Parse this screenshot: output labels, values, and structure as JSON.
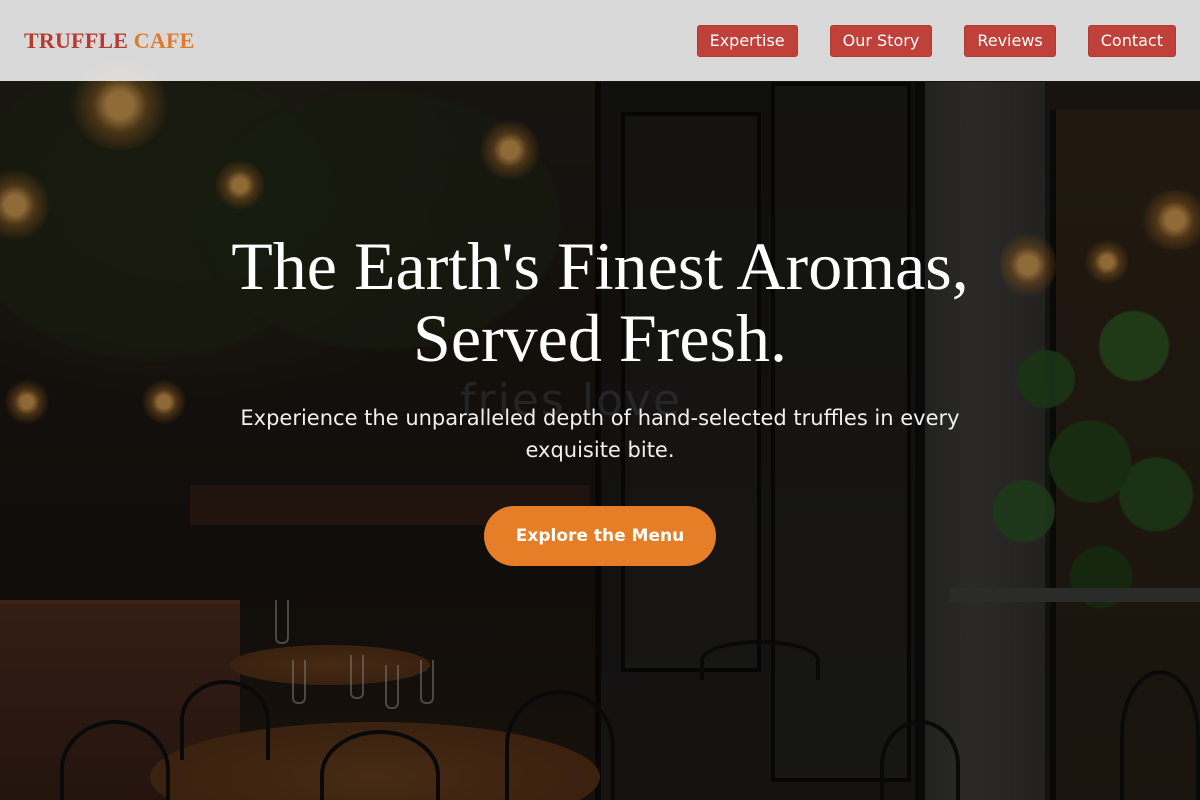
{
  "brand": {
    "word1": "TRUFFLE",
    "word2": "CAFE",
    "color_primary": "#b73a2f",
    "color_secondary": "#e07a2a"
  },
  "nav": {
    "items": [
      {
        "label": "Expertise"
      },
      {
        "label": "Our Story"
      },
      {
        "label": "Reviews"
      },
      {
        "label": "Contact"
      }
    ],
    "button_color": "#c0413a"
  },
  "hero": {
    "headline_line1": "The Earth's Finest Aromas,",
    "headline_line2": "Served Fresh.",
    "subtitle": "Experience the unparalleled depth of hand-selected truffles in every exquisite bite.",
    "cta_label": "Explore the Menu",
    "cta_color": "#e57e26",
    "background_text": "fries love"
  }
}
